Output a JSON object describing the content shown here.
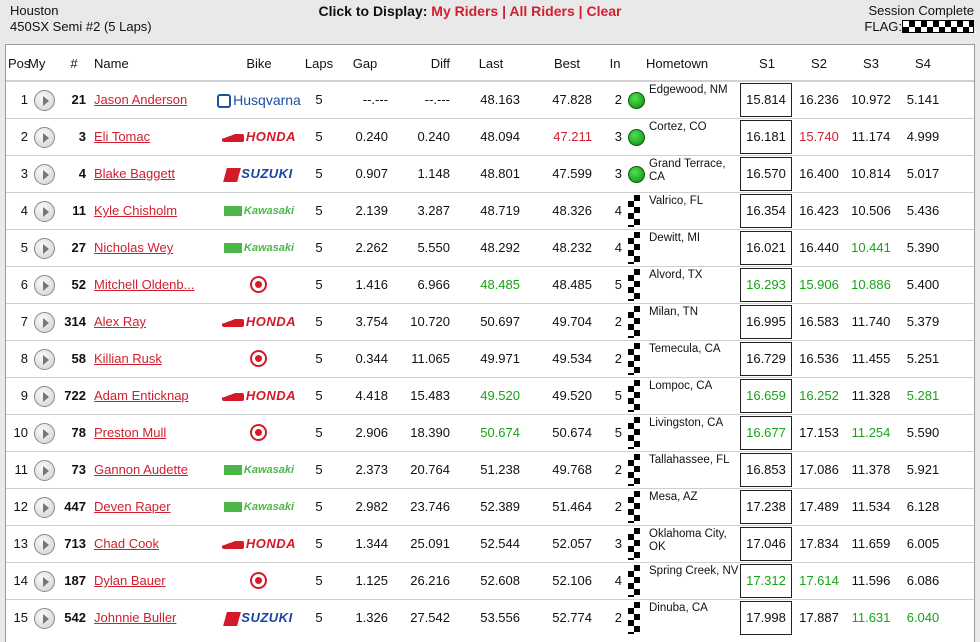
{
  "header": {
    "venue": "Houston",
    "session": "450SX Semi #2 (5 Laps)",
    "click_label": "Click to Display:",
    "my_riders": "My Riders",
    "all_riders": "All Riders",
    "clear": "Clear",
    "separator": "|",
    "status": "Session Complete",
    "flag_label": "FLAG:"
  },
  "columns": [
    "Pos",
    "My",
    "#",
    "Name",
    "Bike",
    "Laps",
    "Gap",
    "Diff",
    "Last",
    "Best",
    "In",
    "Hometown",
    "S1",
    "S2",
    "S3",
    "S4"
  ],
  "colors": {
    "red": "#d01f2e",
    "green": "#16a416"
  },
  "rows": [
    {
      "pos": "1",
      "num": "21",
      "name": "Jason Anderson",
      "bike": "Husqvarna",
      "laps": "5",
      "gap": "--.---",
      "diff": "--.---",
      "last": "48.163",
      "best": "47.828",
      "in": "2",
      "flag": "green-dot",
      "home": "Edgewood, NM",
      "s1": "15.814",
      "s2": "16.236",
      "s3": "10.972",
      "s4": "5.141",
      "hl": {
        "best": "",
        "last": "",
        "s1": "",
        "s2": "",
        "s3": "",
        "s4": ""
      }
    },
    {
      "pos": "2",
      "num": "3",
      "name": "Eli Tomac",
      "bike": "HONDA",
      "laps": "5",
      "gap": "0.240",
      "diff": "0.240",
      "last": "48.094",
      "best": "47.211",
      "in": "3",
      "flag": "green-dot",
      "home": "Cortez, CO",
      "s1": "16.181",
      "s2": "15.740",
      "s3": "11.174",
      "s4": "4.999",
      "hl": {
        "best": "red",
        "last": "",
        "s1": "",
        "s2": "red",
        "s3": "",
        "s4": ""
      }
    },
    {
      "pos": "3",
      "num": "4",
      "name": "Blake Baggett",
      "bike": "SUZUKI",
      "laps": "5",
      "gap": "0.907",
      "diff": "1.148",
      "last": "48.801",
      "best": "47.599",
      "in": "3",
      "flag": "green-dot",
      "home": "Grand Terrace, CA",
      "s1": "16.570",
      "s2": "16.400",
      "s3": "10.814",
      "s4": "5.017",
      "hl": {
        "best": "",
        "last": "",
        "s1": "",
        "s2": "",
        "s3": "",
        "s4": ""
      }
    },
    {
      "pos": "4",
      "num": "11",
      "name": "Kyle Chisholm",
      "bike": "Kawasaki",
      "laps": "5",
      "gap": "2.139",
      "diff": "3.287",
      "last": "48.719",
      "best": "48.326",
      "in": "4",
      "flag": "checkered",
      "home": "Valrico, FL",
      "s1": "16.354",
      "s2": "16.423",
      "s3": "10.506",
      "s4": "5.436",
      "hl": {
        "best": "",
        "last": "",
        "s1": "",
        "s2": "",
        "s3": "",
        "s4": ""
      }
    },
    {
      "pos": "5",
      "num": "27",
      "name": "Nicholas Wey",
      "bike": "Kawasaki",
      "laps": "5",
      "gap": "2.262",
      "diff": "5.550",
      "last": "48.292",
      "best": "48.232",
      "in": "4",
      "flag": "checkered",
      "home": "Dewitt, MI",
      "s1": "16.021",
      "s2": "16.440",
      "s3": "10.441",
      "s4": "5.390",
      "hl": {
        "best": "",
        "last": "",
        "s1": "",
        "s2": "",
        "s3": "green",
        "s4": ""
      }
    },
    {
      "pos": "6",
      "num": "52",
      "name": "Mitchell Oldenb...",
      "bike": "YAMAHA",
      "laps": "5",
      "gap": "1.416",
      "diff": "6.966",
      "last": "48.485",
      "best": "48.485",
      "in": "5",
      "flag": "checkered",
      "home": "Alvord, TX",
      "s1": "16.293",
      "s2": "15.906",
      "s3": "10.886",
      "s4": "5.400",
      "hl": {
        "best": "",
        "last": "green",
        "s1": "green",
        "s2": "green",
        "s3": "green",
        "s4": ""
      }
    },
    {
      "pos": "7",
      "num": "314",
      "name": "Alex Ray",
      "bike": "HONDA",
      "laps": "5",
      "gap": "3.754",
      "diff": "10.720",
      "last": "50.697",
      "best": "49.704",
      "in": "2",
      "flag": "checkered",
      "home": "Milan, TN",
      "s1": "16.995",
      "s2": "16.583",
      "s3": "11.740",
      "s4": "5.379",
      "hl": {
        "best": "",
        "last": "",
        "s1": "",
        "s2": "",
        "s3": "",
        "s4": ""
      }
    },
    {
      "pos": "8",
      "num": "58",
      "name": "Killian Rusk",
      "bike": "YAMAHA",
      "laps": "5",
      "gap": "0.344",
      "diff": "11.065",
      "last": "49.971",
      "best": "49.534",
      "in": "2",
      "flag": "checkered",
      "home": "Temecula, CA",
      "s1": "16.729",
      "s2": "16.536",
      "s3": "11.455",
      "s4": "5.251",
      "hl": {
        "best": "",
        "last": "",
        "s1": "",
        "s2": "",
        "s3": "",
        "s4": ""
      }
    },
    {
      "pos": "9",
      "num": "722",
      "name": "Adam Enticknap",
      "bike": "HONDA",
      "laps": "5",
      "gap": "4.418",
      "diff": "15.483",
      "last": "49.520",
      "best": "49.520",
      "in": "5",
      "flag": "checkered",
      "home": "Lompoc, CA",
      "s1": "16.659",
      "s2": "16.252",
      "s3": "11.328",
      "s4": "5.281",
      "hl": {
        "best": "",
        "last": "green",
        "s1": "green",
        "s2": "green",
        "s3": "",
        "s4": "green"
      }
    },
    {
      "pos": "10",
      "num": "78",
      "name": "Preston Mull",
      "bike": "YAMAHA",
      "laps": "5",
      "gap": "2.906",
      "diff": "18.390",
      "last": "50.674",
      "best": "50.674",
      "in": "5",
      "flag": "checkered",
      "home": "Livingston, CA",
      "s1": "16.677",
      "s2": "17.153",
      "s3": "11.254",
      "s4": "5.590",
      "hl": {
        "best": "",
        "last": "green",
        "s1": "green",
        "s2": "",
        "s3": "green",
        "s4": ""
      }
    },
    {
      "pos": "11",
      "num": "73",
      "name": "Gannon Audette",
      "bike": "Kawasaki",
      "laps": "5",
      "gap": "2.373",
      "diff": "20.764",
      "last": "51.238",
      "best": "49.768",
      "in": "2",
      "flag": "checkered",
      "home": "Tallahassee, FL",
      "s1": "16.853",
      "s2": "17.086",
      "s3": "11.378",
      "s4": "5.921",
      "hl": {
        "best": "",
        "last": "",
        "s1": "",
        "s2": "",
        "s3": "",
        "s4": ""
      }
    },
    {
      "pos": "12",
      "num": "447",
      "name": "Deven Raper",
      "bike": "Kawasaki",
      "laps": "5",
      "gap": "2.982",
      "diff": "23.746",
      "last": "52.389",
      "best": "51.464",
      "in": "2",
      "flag": "checkered",
      "home": "Mesa, AZ",
      "s1": "17.238",
      "s2": "17.489",
      "s3": "11.534",
      "s4": "6.128",
      "hl": {
        "best": "",
        "last": "",
        "s1": "",
        "s2": "",
        "s3": "",
        "s4": ""
      }
    },
    {
      "pos": "13",
      "num": "713",
      "name": "Chad Cook",
      "bike": "HONDA",
      "laps": "5",
      "gap": "1.344",
      "diff": "25.091",
      "last": "52.544",
      "best": "52.057",
      "in": "3",
      "flag": "checkered",
      "home": "Oklahoma City, OK",
      "s1": "17.046",
      "s2": "17.834",
      "s3": "11.659",
      "s4": "6.005",
      "hl": {
        "best": "",
        "last": "",
        "s1": "",
        "s2": "",
        "s3": "",
        "s4": ""
      }
    },
    {
      "pos": "14",
      "num": "187",
      "name": "Dylan Bauer",
      "bike": "YAMAHA",
      "laps": "5",
      "gap": "1.125",
      "diff": "26.216",
      "last": "52.608",
      "best": "52.106",
      "in": "4",
      "flag": "checkered",
      "home": "Spring Creek, NV",
      "s1": "17.312",
      "s2": "17.614",
      "s3": "11.596",
      "s4": "6.086",
      "hl": {
        "best": "",
        "last": "",
        "s1": "green",
        "s2": "green",
        "s3": "",
        "s4": ""
      }
    },
    {
      "pos": "15",
      "num": "542",
      "name": "Johnnie Buller",
      "bike": "SUZUKI",
      "laps": "5",
      "gap": "1.326",
      "diff": "27.542",
      "last": "53.556",
      "best": "52.774",
      "in": "2",
      "flag": "checkered",
      "home": "Dinuba, CA",
      "s1": "17.998",
      "s2": "17.887",
      "s3": "11.631",
      "s4": "6.040",
      "hl": {
        "best": "",
        "last": "",
        "s1": "",
        "s2": "",
        "s3": "green",
        "s4": "green"
      }
    }
  ]
}
